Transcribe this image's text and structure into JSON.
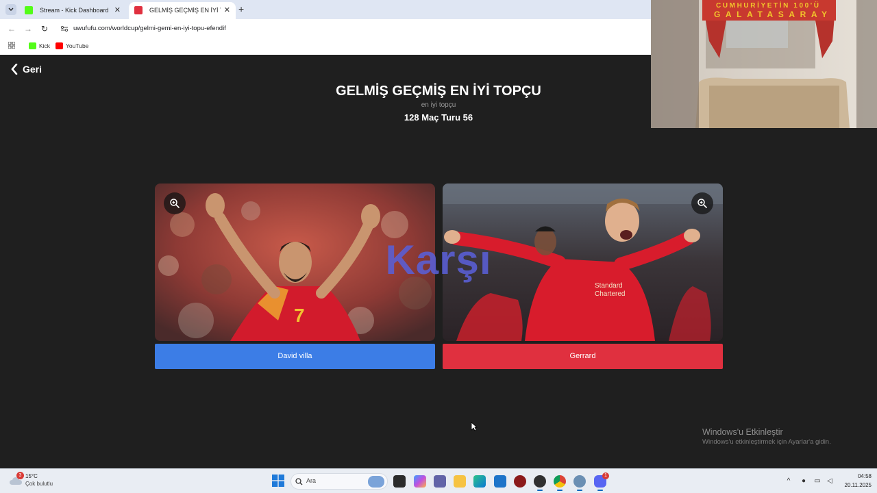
{
  "browser": {
    "tabs": [
      {
        "title": "Stream - Kick Dashboard",
        "favicon_color": "#53fc18",
        "active": false
      },
      {
        "title": "GELMİŞ GEÇMİŞ EN İYİ TOPÇU -",
        "favicon_color": "#e0303f",
        "active": true
      }
    ],
    "url": "uwufufu.com/worldcup/gelmi-gemi-en-iyi-topu-efendif",
    "bookmarks": [
      {
        "label": "Kick",
        "icon_color": "#53fc18"
      },
      {
        "label": "YouTube",
        "icon_color": "#ff0000"
      }
    ]
  },
  "page": {
    "back_label": "Geri",
    "title": "GELMİŞ GEÇMİŞ EN İYİ TOPÇU",
    "subtitle": "en iyi topçu",
    "round_info": "128 Maç Turu 56",
    "vs_label": "Karşı",
    "left_choice": {
      "label": "David villa",
      "color": "#3c7de6"
    },
    "right_choice": {
      "label": "Gerrard",
      "color": "#e0303f"
    },
    "zoom_icon": "zoom-in-icon"
  },
  "watermark": {
    "title": "Windows'u Etkinleştir",
    "subtitle": "Windows'u etkinleştirmek için Ayarlar'a gidin."
  },
  "webcam": {
    "scarf_text": "CUMHURİYETİN 100'Ü GALATASARAY"
  },
  "taskbar": {
    "weather": {
      "temp": "15°C",
      "desc": "Çok bulutlu",
      "badge": "3"
    },
    "search_placeholder": "Ara",
    "pinned": [
      "file-explorer-icon",
      "copilot-icon",
      "teams-icon",
      "folder-icon",
      "edge-icon",
      "store-icon",
      "app-icon",
      "obs-icon",
      "chrome-icon",
      "settings-icon",
      "discord-icon"
    ],
    "discord_badge": "1",
    "clock": {
      "time": "04:58",
      "date": "20.11.2025"
    }
  }
}
